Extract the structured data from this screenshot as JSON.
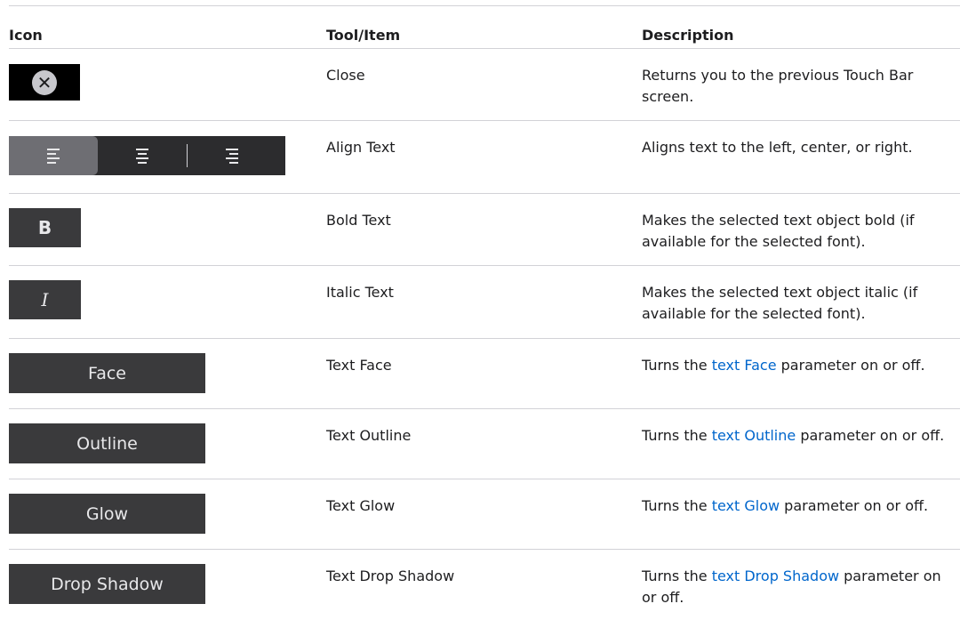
{
  "headers": {
    "icon": "Icon",
    "tool": "Tool/Item",
    "description": "Description"
  },
  "rows": [
    {
      "icon_name": "close-icon",
      "icon_glyph": "✕",
      "tool": "Close",
      "desc_pre": "Returns you to the previous Touch Bar screen.",
      "desc_link": "",
      "desc_post": ""
    },
    {
      "icon_name": "align-text-icon",
      "tool": "Align Text",
      "desc_pre": "Aligns text to the left, center, or right.",
      "desc_link": "",
      "desc_post": ""
    },
    {
      "icon_name": "bold-icon",
      "icon_label": "B",
      "tool": "Bold Text",
      "desc_pre": "Makes the selected text object bold (if available for the selected font).",
      "desc_link": "",
      "desc_post": ""
    },
    {
      "icon_name": "italic-icon",
      "icon_label": "I",
      "tool": "Italic Text",
      "desc_pre": "Makes the selected text object italic (if available for the selected font).",
      "desc_link": "",
      "desc_post": ""
    },
    {
      "icon_name": "face-button",
      "icon_label": "Face",
      "tool": "Text Face",
      "desc_pre": "Turns the ",
      "desc_link": "text Face",
      "desc_post": " parameter on or off."
    },
    {
      "icon_name": "outline-button",
      "icon_label": "Outline",
      "tool": "Text Outline",
      "desc_pre": "Turns the ",
      "desc_link": "text Outline",
      "desc_post": " parameter on or off."
    },
    {
      "icon_name": "glow-button",
      "icon_label": "Glow",
      "tool": "Text Glow",
      "desc_pre": "Turns the ",
      "desc_link": "text Glow",
      "desc_post": " parameter on or off."
    },
    {
      "icon_name": "drop-shadow-button",
      "icon_label": "Drop Shadow",
      "tool": "Text Drop Shadow",
      "desc_pre": "Turns the ",
      "desc_link": "text Drop Shadow",
      "desc_post": " parameter on or off."
    }
  ],
  "colors": {
    "link": "#0066cc",
    "touchbar_button": "#3a3a3c",
    "touchbar_black": "#000000",
    "rule": "#d2d2d7"
  }
}
